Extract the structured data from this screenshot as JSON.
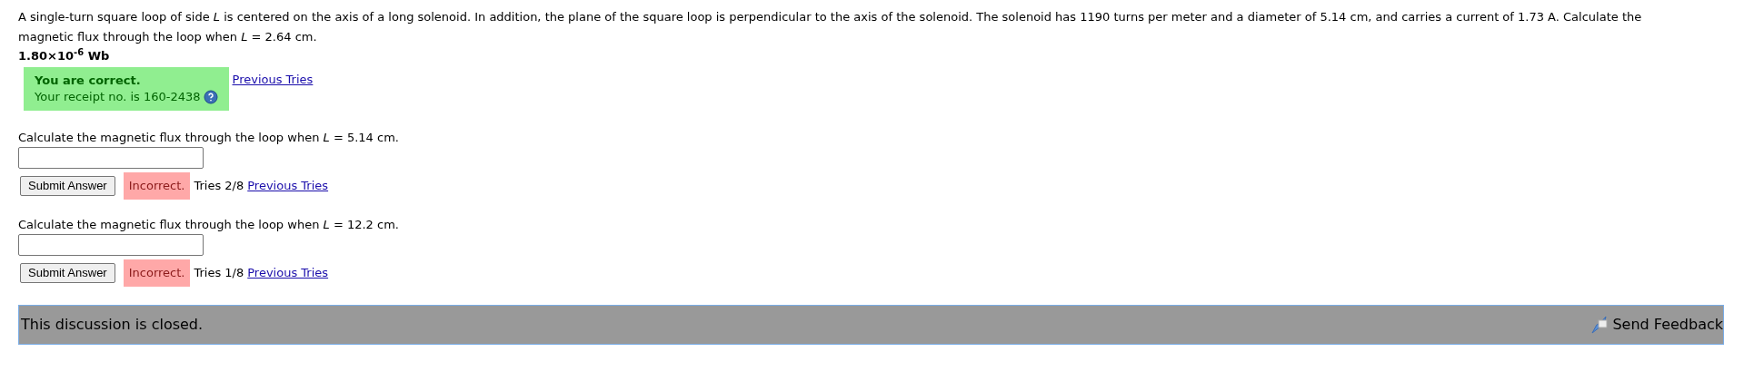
{
  "problem": {
    "text": "A single-turn square loop of side *L* is centered on the axis of a long solenoid. In addition, the plane of the square loop is perpendicular to the axis of the solenoid. The solenoid has 1190 turns per meter and a diameter of 5.14 cm, and carries a current of 1.73 A. Calculate the magnetic flux through the loop when *L* = 2.64 cm.",
    "answer": "1.80×10$^{-6}$ Wb",
    "feedback": {
      "kind": "correct",
      "title": "You are correct.",
      "receipt": "Your receipt no. is 160-2438"
    },
    "link": "Previous Tries"
  },
  "parts": [
    {
      "prompt": "Calculate the magnetic flux through the loop when *L* = 5.14 cm.",
      "button": "Submit Answer",
      "status": {
        "kind": "incorrect",
        "label": "Incorrect."
      },
      "tries": "Tries 2/8",
      "link": "Previous Tries"
    },
    {
      "prompt": "Calculate the magnetic flux through the loop when *L* = 12.2 cm.",
      "button": "Submit Answer",
      "status": {
        "kind": "incorrect",
        "label": "Incorrect."
      },
      "tries": "Tries 1/8",
      "link": "Previous Tries"
    }
  ],
  "footer": {
    "text": "This discussion is closed.",
    "feedback": "Send Feedback"
  }
}
